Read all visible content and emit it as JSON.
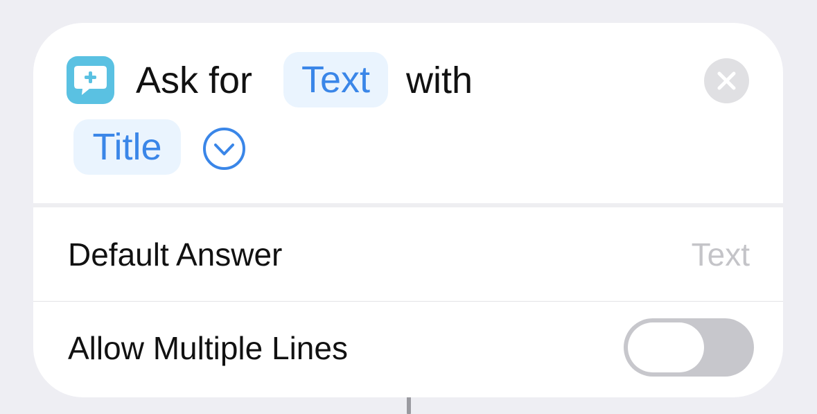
{
  "action": {
    "ask_prefix": "Ask for",
    "type_token": "Text",
    "with_word": "with",
    "title_token": "Title"
  },
  "rows": [
    {
      "label": "Default Answer",
      "value": "Text"
    },
    {
      "label": "Allow Multiple Lines",
      "toggle_on": false
    }
  ],
  "icons": {
    "app": "speech-bubble-plus-icon",
    "expand": "chevron-down-circle-icon",
    "close": "close-icon"
  },
  "colors": {
    "accent": "#3a86e8",
    "chip_background": "#eaf4fe",
    "app_icon": "#5ac1e2",
    "placeholder": "#c4c4c8",
    "toggle_off": "#c7c7cc"
  }
}
